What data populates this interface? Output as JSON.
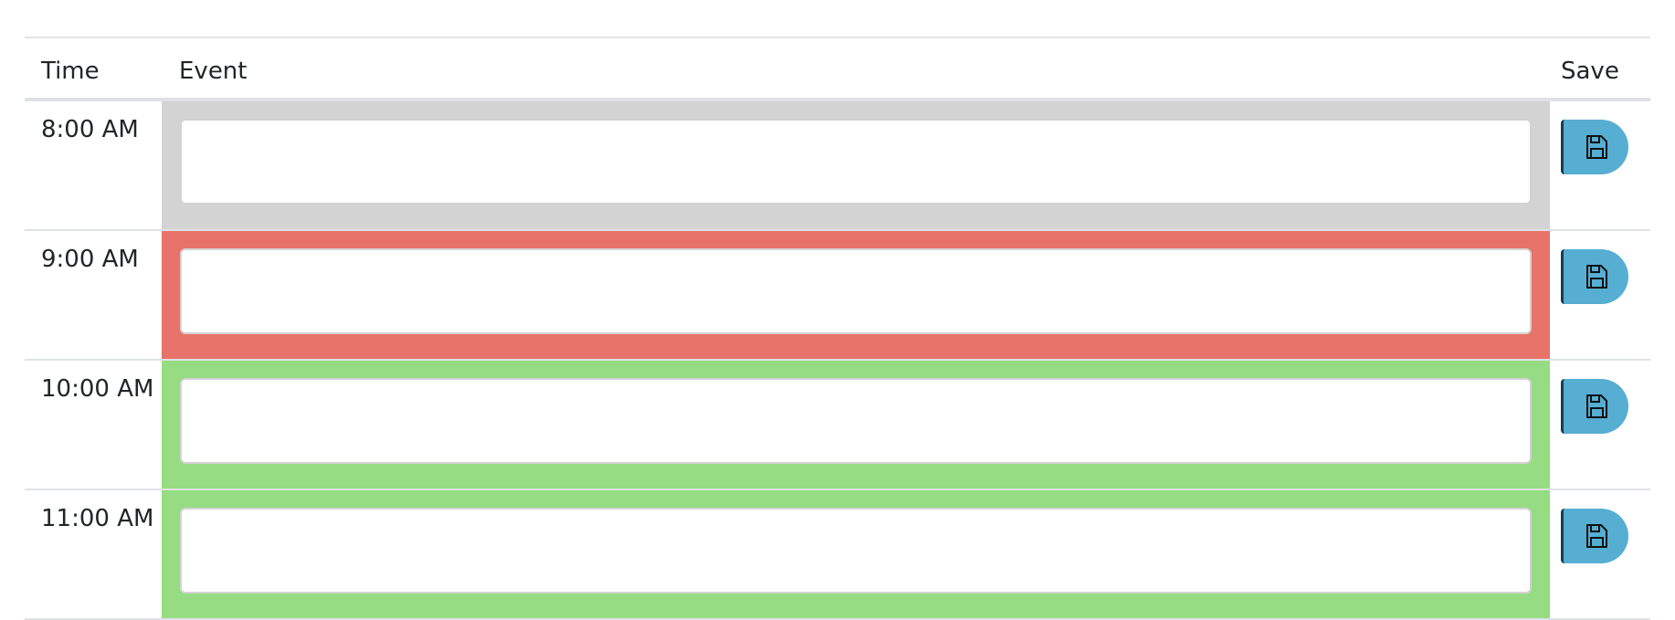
{
  "table": {
    "headers": {
      "time": "Time",
      "event": "Event",
      "save": "Save"
    },
    "rows": [
      {
        "time": "8:00 AM",
        "status": "past",
        "event_value": "",
        "color": "#d3d3d3",
        "save_icon": "floppy-disk-icon"
      },
      {
        "time": "9:00 AM",
        "status": "present",
        "event_value": "",
        "color": "#e8736a",
        "save_icon": "floppy-disk-icon"
      },
      {
        "time": "10:00 AM",
        "status": "future",
        "event_value": "",
        "color": "#96dc82",
        "save_icon": "floppy-disk-icon"
      },
      {
        "time": "11:00 AM",
        "status": "future",
        "event_value": "",
        "color": "#96dc82",
        "save_icon": "floppy-disk-icon"
      }
    ]
  },
  "colors": {
    "save_button": "#56aed2",
    "past": "#d3d3d3",
    "present": "#e8736a",
    "future": "#96dc82"
  }
}
